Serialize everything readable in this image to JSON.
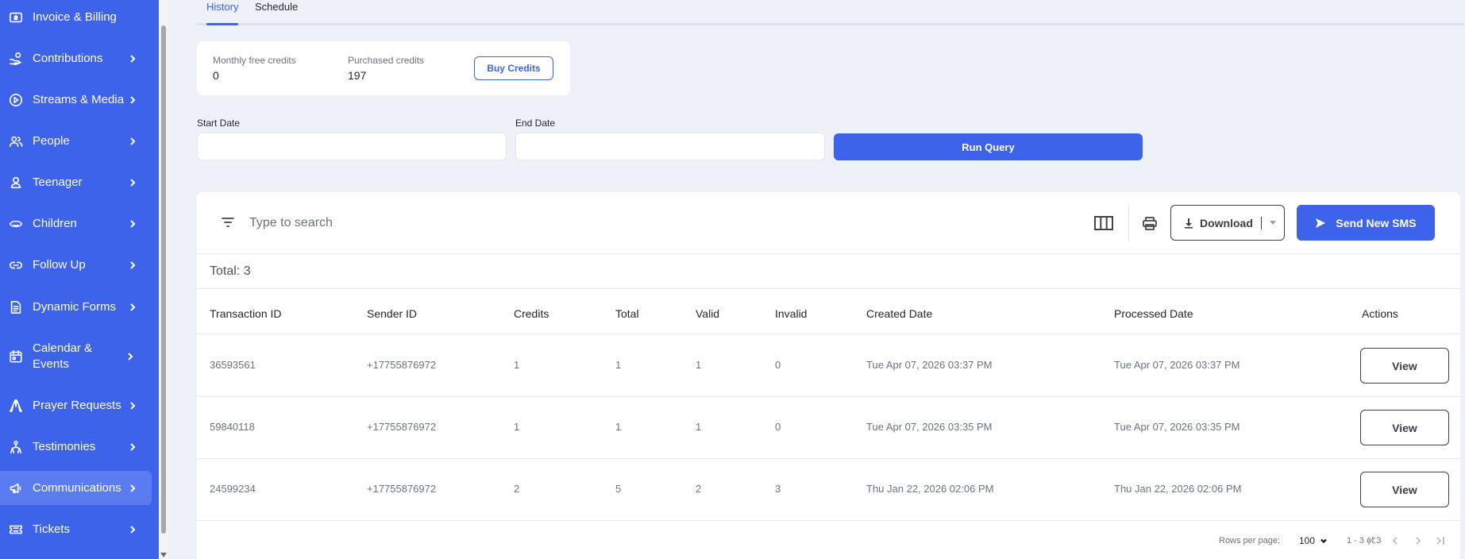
{
  "sidebar": {
    "items": [
      {
        "label": "Invoice & Billing",
        "icon": "invoice-icon",
        "chevron": false
      },
      {
        "label": "Contributions",
        "icon": "hand-coin-icon",
        "chevron": true
      },
      {
        "label": "Streams & Media",
        "icon": "play-circle-icon",
        "chevron": true
      },
      {
        "label": "People",
        "icon": "people-icon",
        "chevron": true
      },
      {
        "label": "Teenager",
        "icon": "person-icon",
        "chevron": true
      },
      {
        "label": "Children",
        "icon": "face-icon",
        "chevron": true
      },
      {
        "label": "Follow Up",
        "icon": "link-icon",
        "chevron": true
      },
      {
        "label": "Dynamic Forms",
        "icon": "form-icon",
        "chevron": true
      },
      {
        "label": "Calendar & Events",
        "icon": "calendar-icon",
        "chevron": true
      },
      {
        "label": "Prayer Requests",
        "icon": "praying-hands-icon",
        "chevron": true
      },
      {
        "label": "Testimonies",
        "icon": "people-group-icon",
        "chevron": true
      },
      {
        "label": "Communications",
        "icon": "megaphone-icon",
        "chevron": true,
        "active": true
      },
      {
        "label": "Tickets",
        "icon": "ticket-icon",
        "chevron": true
      }
    ]
  },
  "tabs": [
    {
      "label": "History",
      "active": true
    },
    {
      "label": "Schedule",
      "active": false
    }
  ],
  "credits": {
    "monthly_label": "Monthly free credits",
    "monthly_value": "0",
    "purchased_label": "Purchased credits",
    "purchased_value": "197",
    "buy_label": "Buy Credits"
  },
  "query": {
    "start_label": "Start Date",
    "end_label": "End Date",
    "run_label": "Run Query"
  },
  "toolbar": {
    "search_placeholder": "Type to search",
    "download_label": "Download",
    "send_label": "Send New SMS"
  },
  "table": {
    "total_text": "Total: 3",
    "columns": [
      "Transaction ID",
      "Sender ID",
      "Credits",
      "Total",
      "Valid",
      "Invalid",
      "Created Date",
      "Processed Date",
      "Actions"
    ],
    "rows": [
      {
        "transaction_id": "36593561",
        "sender_id": "+17755876972",
        "credits": "1",
        "total": "1",
        "valid": "1",
        "invalid": "0",
        "created": "Tue Apr 07, 2026 03:37 PM",
        "processed": "Tue Apr 07, 2026 03:37 PM",
        "action": "View"
      },
      {
        "transaction_id": "59840118",
        "sender_id": "+17755876972",
        "credits": "1",
        "total": "1",
        "valid": "1",
        "invalid": "0",
        "created": "Tue Apr 07, 2026 03:35 PM",
        "processed": "Tue Apr 07, 2026 03:35 PM",
        "action": "View"
      },
      {
        "transaction_id": "24599234",
        "sender_id": "+17755876972",
        "credits": "2",
        "total": "5",
        "valid": "2",
        "invalid": "3",
        "created": "Thu Jan 22, 2026 02:06 PM",
        "processed": "Thu Jan 22, 2026 02:06 PM",
        "action": "View"
      }
    ]
  },
  "pagination": {
    "rows_per_page_label": "Rows per page:",
    "rows_per_page": "100",
    "range": "1 - 3 of 3"
  },
  "colors": {
    "primary": "#3d63ea",
    "sidebar_bg": "#3d63ea",
    "sidebar_active": "#5a7cf0",
    "page_bg": "#eef1f7"
  }
}
